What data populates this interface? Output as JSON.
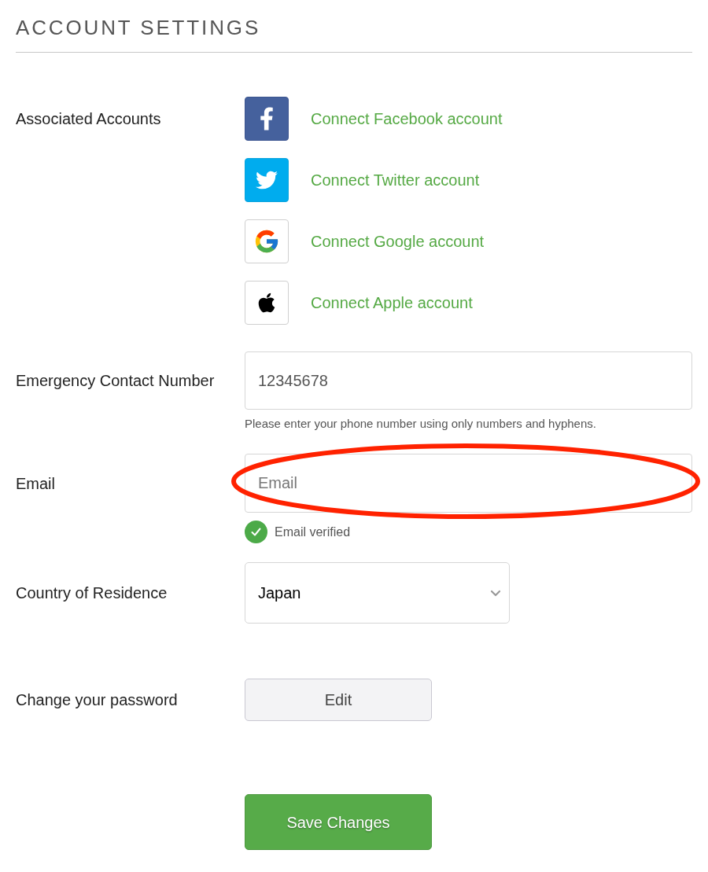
{
  "title": "ACCOUNT SETTINGS",
  "associated_accounts": {
    "label": "Associated Accounts",
    "items": [
      {
        "kind": "facebook",
        "label": "Connect Facebook account"
      },
      {
        "kind": "twitter",
        "label": "Connect Twitter account"
      },
      {
        "kind": "google",
        "label": "Connect Google account"
      },
      {
        "kind": "apple",
        "label": "Connect Apple account"
      }
    ]
  },
  "emergency_contact": {
    "label": "Emergency Contact Number",
    "value": "12345678",
    "help": "Please enter your phone number using only numbers and hyphens."
  },
  "email": {
    "label": "Email",
    "placeholder": "Email",
    "highlighted": true,
    "verified": true,
    "status": "Email verified"
  },
  "country": {
    "label": "Country of Residence",
    "value": "Japan"
  },
  "password": {
    "label": "Change your password",
    "button": "Edit"
  },
  "save_button": "Save Changes"
}
